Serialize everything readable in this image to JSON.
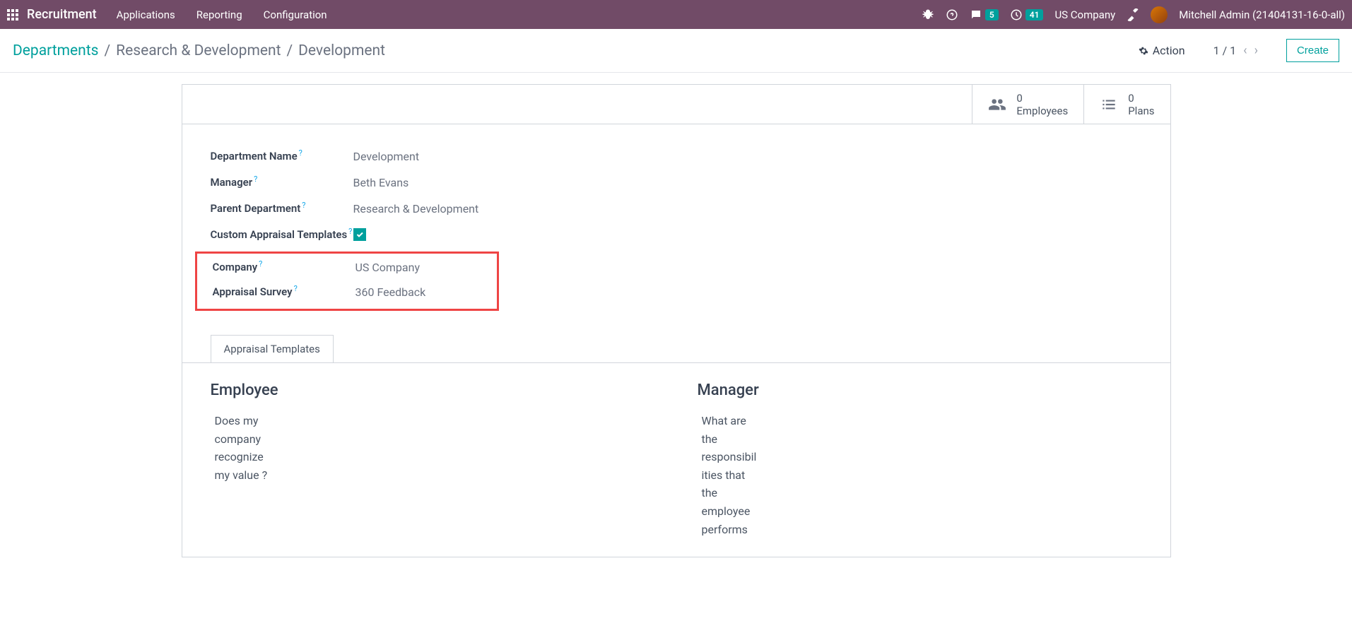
{
  "topbar": {
    "app_title": "Recruitment",
    "menu": [
      "Applications",
      "Reporting",
      "Configuration"
    ],
    "messages_badge": "5",
    "activities_badge": "41",
    "company": "US Company",
    "user": "Mitchell Admin (21404131-16-0-all)"
  },
  "controlbar": {
    "breadcrumb": [
      "Departments",
      "Research & Development",
      "Development"
    ],
    "action_label": "Action",
    "pager": "1 / 1",
    "create_label": "Create"
  },
  "stats": {
    "employees": {
      "count": "0",
      "label": "Employees"
    },
    "plans": {
      "count": "0",
      "label": "Plans"
    }
  },
  "form": {
    "department_name": {
      "label": "Department Name",
      "value": "Development"
    },
    "manager": {
      "label": "Manager",
      "value": "Beth Evans"
    },
    "parent_department": {
      "label": "Parent Department",
      "value": "Research & Development"
    },
    "custom_templates": {
      "label": "Custom Appraisal Templates",
      "checked": true
    },
    "company": {
      "label": "Company",
      "value": "US Company"
    },
    "appraisal_survey": {
      "label": "Appraisal Survey",
      "value": "360 Feedback"
    }
  },
  "tabs": {
    "appraisal_templates": {
      "label": "Appraisal Templates",
      "employee": {
        "heading": "Employee",
        "text": "Does my company recognize my value ?"
      },
      "manager": {
        "heading": "Manager",
        "text": "What are the responsibilities that the employee performs"
      }
    }
  }
}
